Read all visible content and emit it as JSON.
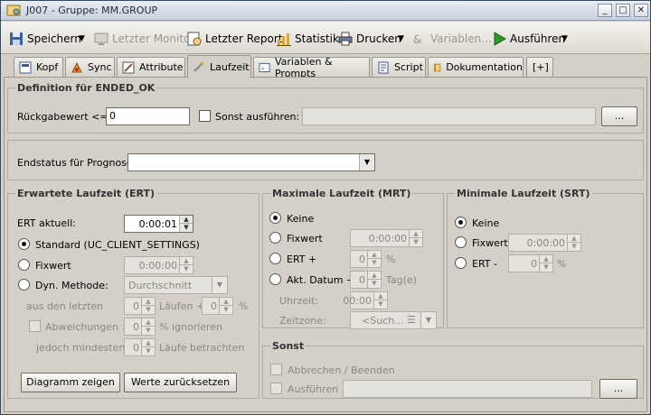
{
  "window": {
    "title": "J007 - Gruppe: MM.GROUP",
    "minimize": "_",
    "maximize": "□",
    "close": "✕"
  },
  "toolbar": {
    "save": "Speichern",
    "last_monitor": "Letzter Monitor",
    "last_report": "Letzter Report",
    "statistics": "Statistik",
    "print": "Drucken",
    "variables": "Variablen...",
    "execute": "Ausführen",
    "dropdown_arrow": "▼"
  },
  "tabs": [
    {
      "label": "Kopf"
    },
    {
      "label": "Sync"
    },
    {
      "label": "Attribute"
    },
    {
      "label": "Laufzeit"
    },
    {
      "label": "Variablen & Prompts"
    },
    {
      "label": "Script"
    },
    {
      "label": "Dokumentation"
    },
    {
      "label": "[+]"
    }
  ],
  "ended_ok": {
    "legend": "Definition für ENDED_OK",
    "return_label": "Rückgabewert <=:",
    "return_value": "0",
    "else_label": "Sonst ausführen:",
    "else_value": "",
    "browse": "..."
  },
  "forecast": {
    "label": "Endstatus für Prognose:",
    "value": ""
  },
  "ert": {
    "legend": "Erwartete Laufzeit (ERT)",
    "current_label": "ERT aktuell:",
    "current_value": "0:00:01",
    "standard_label": "Standard (UC_CLIENT_SETTINGS)",
    "fixed_label": "Fixwert",
    "fixed_value": "0:00:00",
    "dyn_label": "Dyn. Methode:",
    "dyn_value": "Durchschnitt",
    "from_last_label": "aus den letzten",
    "from_last_value": "0",
    "runs_plus_label": "Läufen +",
    "runs_plus_value": "0",
    "percent": "%",
    "deviations_label": "Abweichungen >",
    "deviations_value": "0",
    "ignore_label": "% ignorieren",
    "at_least_label": "jedoch mindestens:",
    "at_least_value": "0",
    "consider_label": "Läufe betrachten",
    "show_chart": "Diagramm zeigen",
    "reset_values": "Werte zurücksetzen"
  },
  "mrt": {
    "legend": "Maximale Laufzeit (MRT)",
    "none_label": "Keine",
    "fixed_label": "Fixwert",
    "fixed_value": "0:00:00",
    "ert_plus_label": "ERT +",
    "ert_plus_value": "0",
    "percent": "%",
    "date_label": "Akt. Datum +",
    "date_value": "0",
    "days_label": "Tag(e)",
    "time_label": "Uhrzeit:",
    "time_value": "00:00",
    "timezone_label": "Zeitzone:",
    "timezone_value": "<Such..."
  },
  "srt": {
    "legend": "Minimale Laufzeit (SRT)",
    "none_label": "Keine",
    "fixed_label": "Fixwert",
    "fixed_value": "0:00:00",
    "ert_minus_label": "ERT -",
    "ert_minus_value": "0",
    "percent": "%"
  },
  "else_group": {
    "legend": "Sonst",
    "abort_label": "Abbrechen / Beenden",
    "execute_label": "Ausführen",
    "execute_value": "",
    "browse": "..."
  }
}
